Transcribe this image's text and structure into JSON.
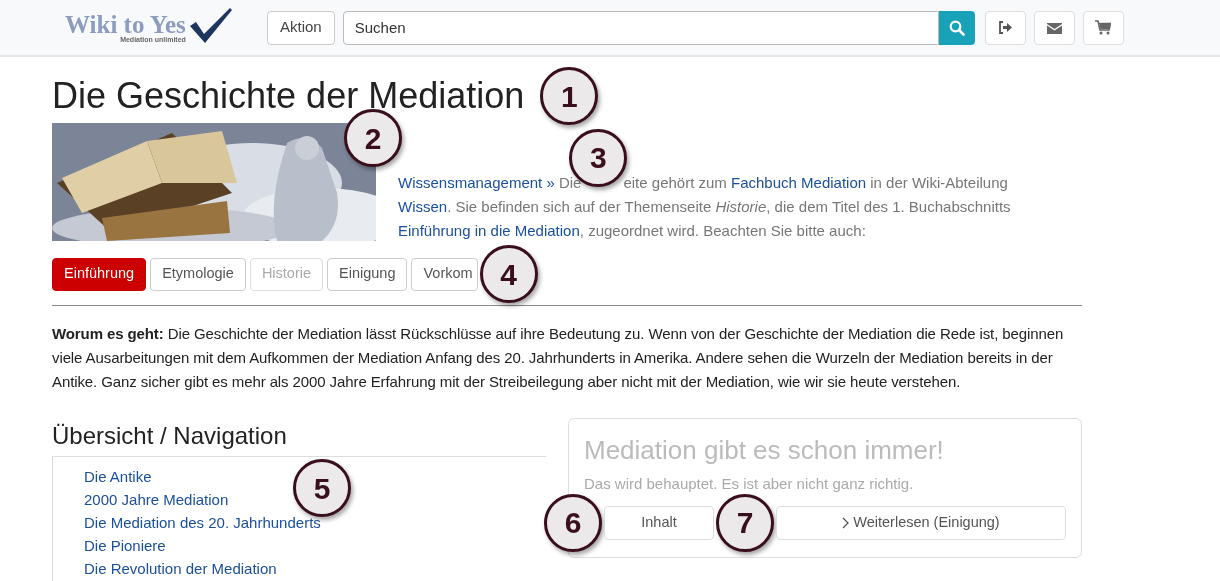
{
  "header": {
    "logo": {
      "title": "Wiki to Yes",
      "tagline": "Mediation unlimited"
    },
    "action_button": "Aktion",
    "search": {
      "placeholder": "Suchen"
    }
  },
  "title": {
    "text": "Die Geschichte der Mediation",
    "callout": "1"
  },
  "image": {
    "kind": "picture",
    "callout": "2"
  },
  "intro": {
    "breadcrumb": "Wissensmanagement »",
    "before_callout": "Die",
    "callout": "3",
    "after_callout": [
      {
        "kind": "text",
        "text": "eite gehört zum"
      },
      {
        "kind": "link",
        "text": "Fachbuch Mediation"
      },
      {
        "kind": "text",
        "text": "in der Wiki-Abteilung"
      },
      {
        "kind": "link",
        "text": "Wissen"
      },
      {
        "kind": "text",
        "text": ". Sie befinden sich auf der Themenseite *Historie*, die dem Titel des 1. Buchabschnitts"
      },
      {
        "kind": "link",
        "text": "Einführung in die Mediation"
      },
      {
        "kind": "text",
        "text": ", zugeordnet wird. Beachten Sie bitte auch:"
      }
    ]
  },
  "tabs": {
    "callout": "4",
    "items": [
      {
        "label": "Einführung",
        "selected": true,
        "disabled": false
      },
      {
        "label": "Etymologie",
        "selected": false,
        "disabled": false
      },
      {
        "label": "Historie",
        "selected": false,
        "disabled": true
      },
      {
        "label": "Einigung",
        "selected": false,
        "disabled": false
      },
      {
        "label": "Vorkom",
        "selected": false,
        "disabled": false
      }
    ]
  },
  "summary": "**Worum es geht:** Die Geschichte der Mediation lässt Rückschlüsse auf ihre Bedeutung zu. Wenn von der Geschichte der Mediation die Rede ist, beginnen viele Ausarbeitungen mit dem Aufkommen der Mediation Anfang des 20. Jahrhunderts in Amerika. Andere sehen die Wurzeln der Mediation bereits in der Antike. Ganz sicher gibt es mehr als 2000 Jahre Erfahrung mit der Streibeilegung aber nicht mit der Mediation, wie wir sie heute verstehen.",
  "navigation": {
    "heading": "Übersicht / Navigation",
    "callout": "5",
    "links": [
      "Die Antike",
      "2000 Jahre Mediation",
      "Die Mediation des 20. Jahrhunderts",
      "Die Pioniere",
      "Die Revolution der Mediation"
    ]
  },
  "card": {
    "title": "Mediation gibt es schon immer!",
    "text": "Das wird behauptet. Es ist aber nicht ganz richtig.",
    "buttons": [
      {
        "label": "Inhalt",
        "callout": "6"
      },
      {
        "label": "Weiterlesen (Einigung)",
        "callout": "7"
      }
    ]
  }
}
